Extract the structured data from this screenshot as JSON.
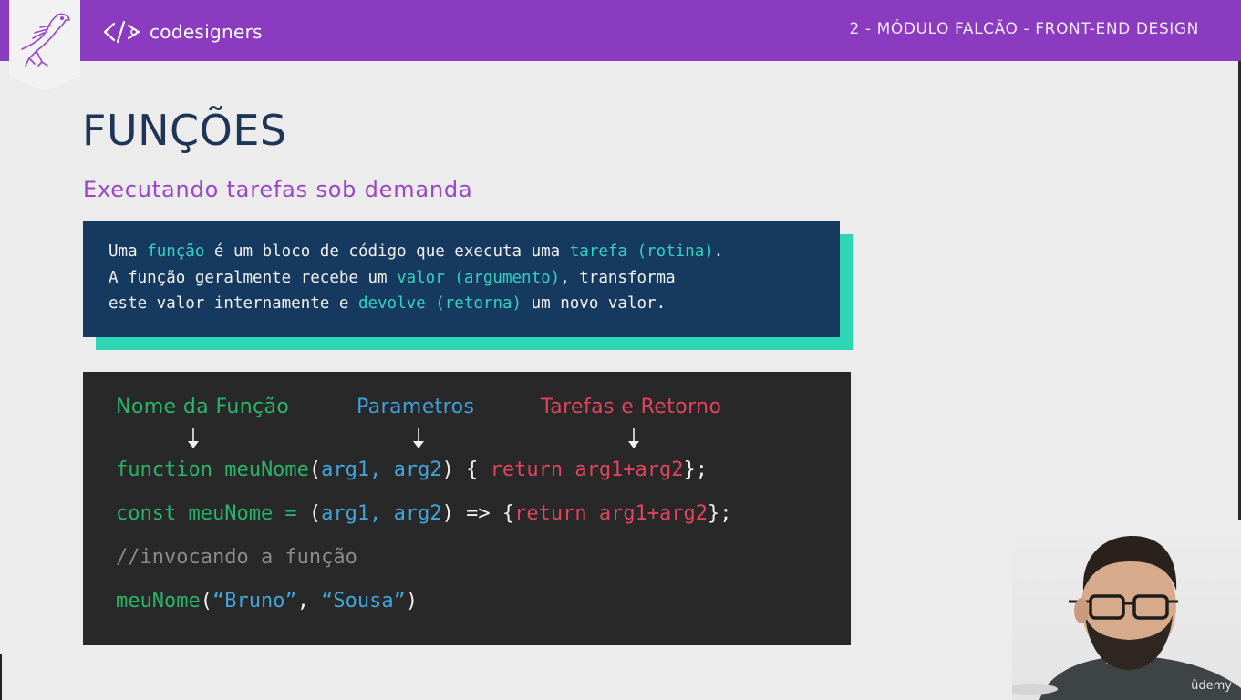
{
  "header": {
    "brand_name": "codesigners",
    "module_title": "2 - MÓDULO FALCÃO - FRONT-END DESIGN"
  },
  "slide": {
    "title": "FUNÇÕES",
    "subtitle": "Executando tarefas sob demanda"
  },
  "info": {
    "l1_a": "Uma ",
    "l1_b": "função",
    "l1_c": " é um bloco de código que executa uma ",
    "l1_d": "tarefa (rotina)",
    "l1_e": ".",
    "l2_a": "A função geralmente recebe um ",
    "l2_b": "valor (argumento)",
    "l2_c": ", transforma",
    "l3_a": "este valor internamente e ",
    "l3_b": "devolve (retorna)",
    "l3_c": " um novo valor."
  },
  "code": {
    "labels": {
      "name": "Nome da Função",
      "params": "Parametros",
      "tasks": "Tarefas e Retorno"
    },
    "line1": {
      "kw": "function meuNome",
      "p_open": "(",
      "args": "arg1, arg2",
      "p_close": ") { ",
      "ret": "return arg1+arg2",
      "end": "};"
    },
    "line2": {
      "kw": "const meuNome = ",
      "p_open": "(",
      "args": "arg1, arg2",
      "p_close": ") => {",
      "ret": "return arg1+arg2",
      "end": "};"
    },
    "line3": "//invocando a função",
    "line4": {
      "fn": "meuNome",
      "open": "(",
      "s1": "“Bruno”",
      "sep": ", ",
      "s2": "“Sousa”",
      "close": ")"
    }
  },
  "watermark": "ûdemy",
  "colors": {
    "header_bg": "#8b3bbf",
    "title": "#1e3557",
    "subtitle": "#9b45c7",
    "info_bg": "#163a5f",
    "info_accent": "#2fd6b5",
    "code_bg": "#282828",
    "green": "#27b36a",
    "blue": "#41a5dc",
    "red": "#e0445f"
  },
  "icons": {
    "badge": "falcon-icon",
    "brand": "code-brackets-icon",
    "arrows": "arrow-down-icon"
  }
}
